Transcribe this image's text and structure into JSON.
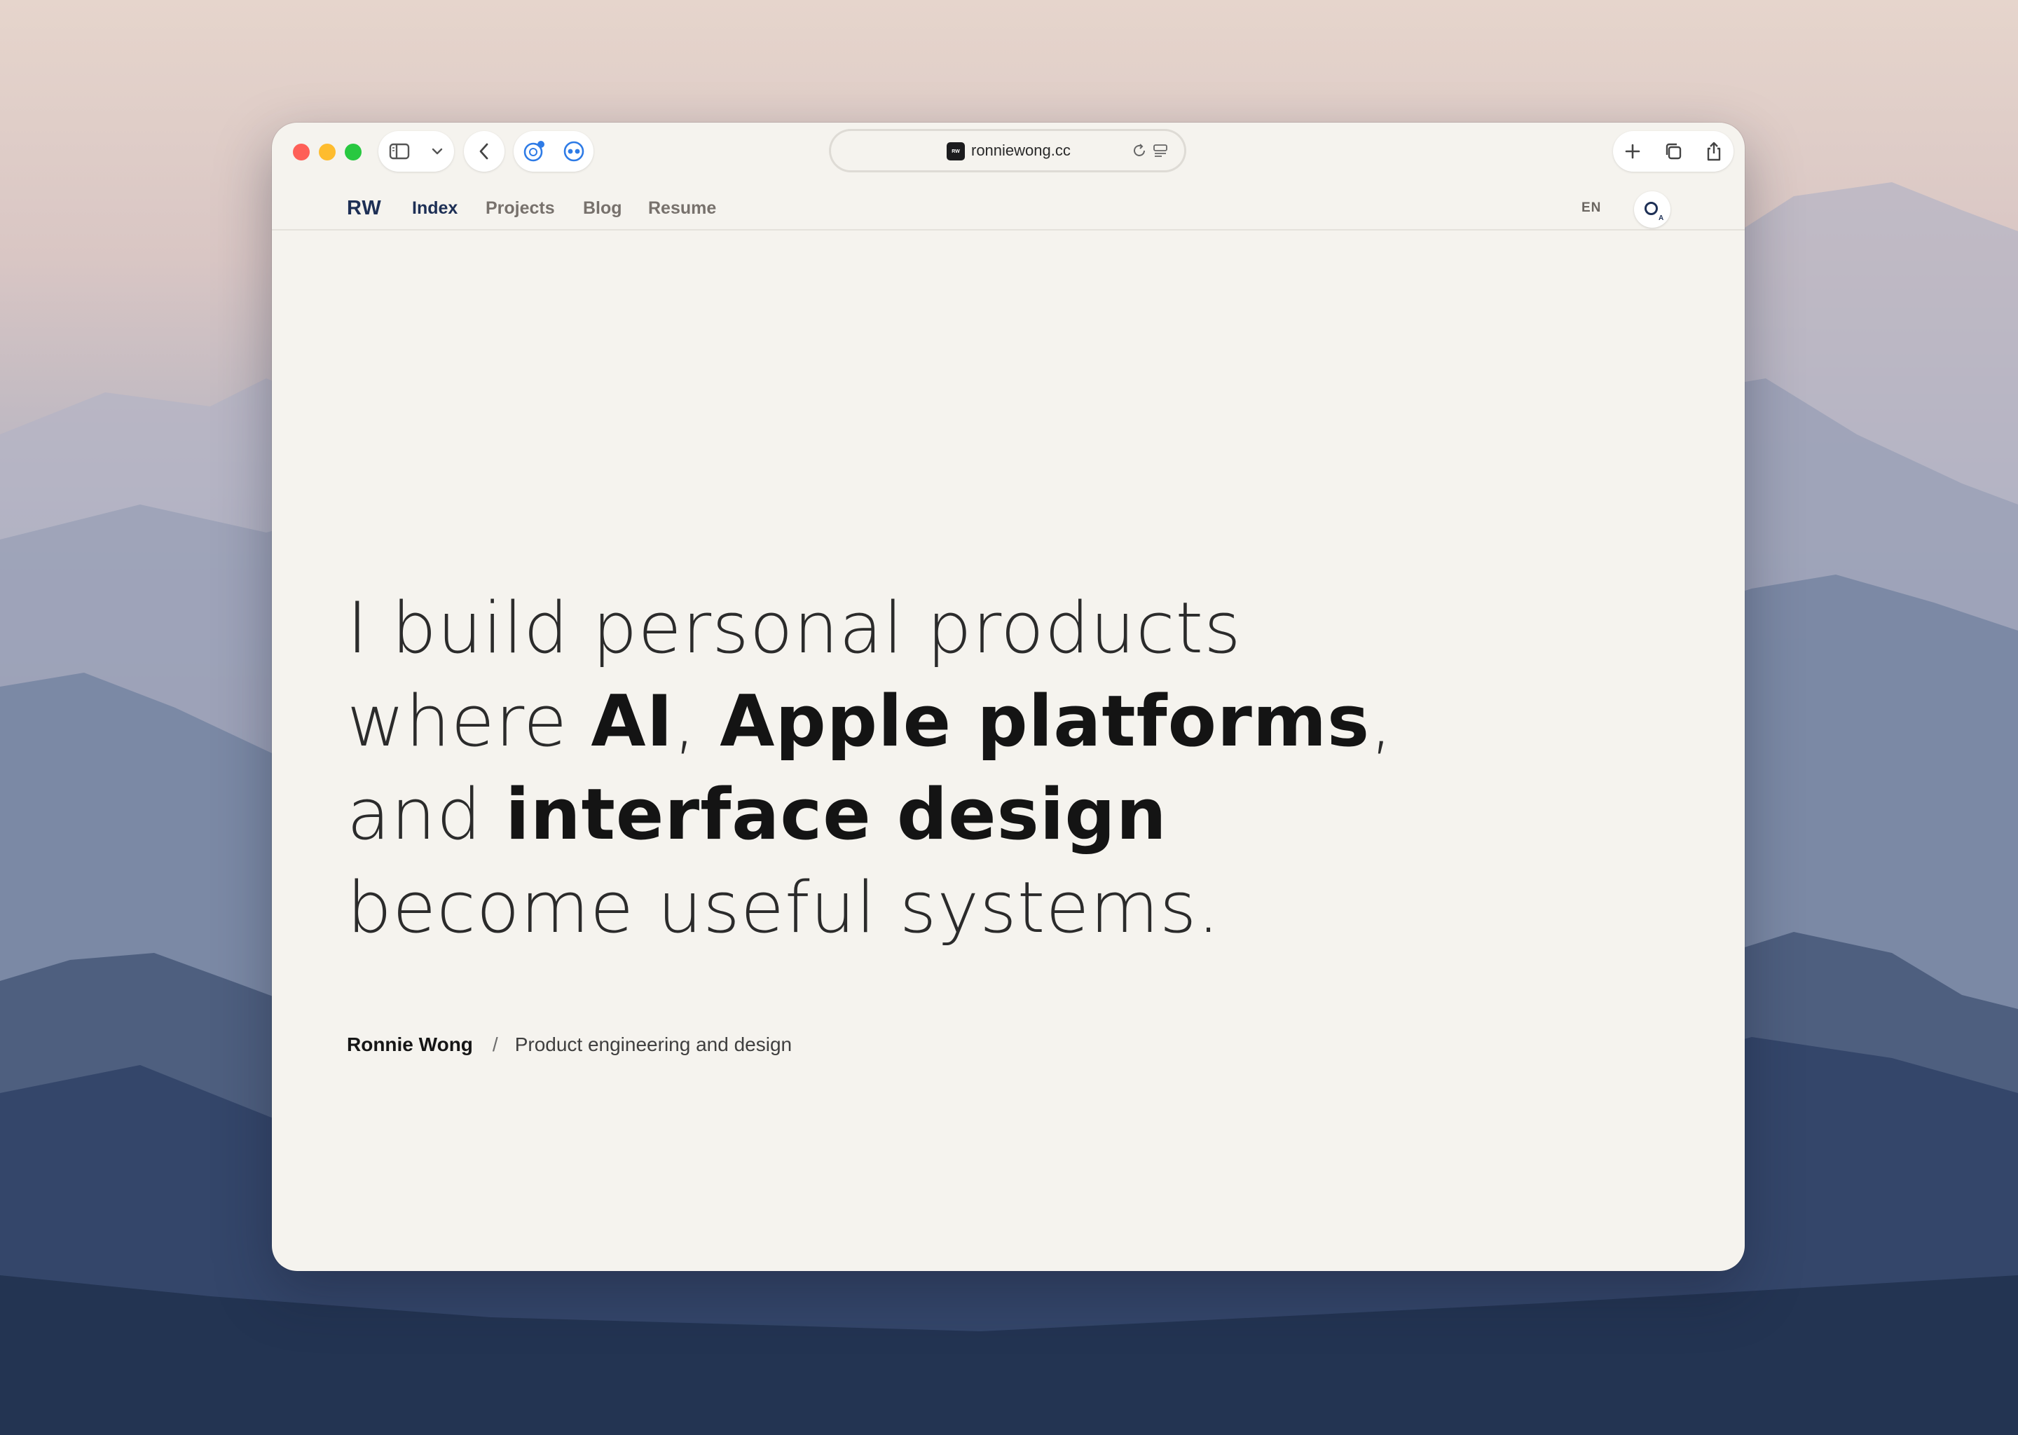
{
  "browser": {
    "url": "ronniewong.cc",
    "favicon_text": "RW"
  },
  "site": {
    "logo": "RW",
    "nav": [
      "Index",
      "Projects",
      "Blog",
      "Resume"
    ],
    "language": "EN",
    "theme_badge": "A"
  },
  "hero": {
    "line1": "I build personal products",
    "line2_a": "where ",
    "line2_b": "AI",
    "line2_c": ", ",
    "line2_d": "Apple platforms",
    "line2_e": ",",
    "line3_a": "and ",
    "line3_b": "interface design",
    "line4": "become useful systems."
  },
  "signature": {
    "name": "Ronnie Wong",
    "separator": "/",
    "role": "Product engineering and design"
  },
  "icons": [
    "sidebar-icon",
    "chevron-down-icon",
    "back-icon",
    "extension-icon",
    "extension-eyes-icon",
    "reload-icon",
    "reader-icon",
    "new-tab-icon",
    "tabs-overview-icon",
    "share-icon",
    "theme-toggle-icon"
  ]
}
